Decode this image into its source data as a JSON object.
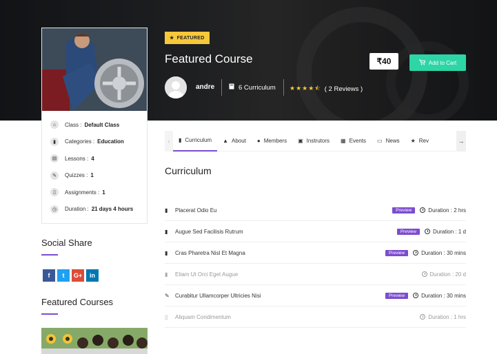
{
  "hero": {
    "badge": "FEATURED",
    "title": "Featured Course",
    "price": "₹40",
    "cart_label": "Add to Cart",
    "author": "andre",
    "curriculum_count": "6 Curriculum",
    "rating_stars": 4.5,
    "stars_text": "★★★★⯪",
    "reviews": "( 2 Reviews )"
  },
  "info": [
    {
      "label": "Class :",
      "value": "Default Class",
      "icon": "class-icon",
      "glyph": "⌂"
    },
    {
      "label": "Categories :",
      "value": "Education",
      "icon": "bookmark-icon",
      "glyph": "▮"
    },
    {
      "label": "Lessons :",
      "value": "4",
      "icon": "book-icon",
      "glyph": "▤"
    },
    {
      "label": "Quizzes :",
      "value": "1",
      "icon": "quiz-icon",
      "glyph": "✎"
    },
    {
      "label": "Assignments :",
      "value": "1",
      "icon": "file-icon",
      "glyph": "▯"
    },
    {
      "label": "Duration :",
      "value": "21 days 4 hours",
      "icon": "clock-icon",
      "glyph": "◷"
    }
  ],
  "sidebar": {
    "social_title": "Social Share",
    "featured_title": "Featured Courses",
    "share": [
      {
        "label": "f",
        "color": "#3b5998",
        "name": "facebook-share-button"
      },
      {
        "label": "t",
        "color": "#1da1f2",
        "name": "twitter-share-button"
      },
      {
        "label": "G+",
        "color": "#dd4b39",
        "name": "googleplus-share-button"
      },
      {
        "label": "in",
        "color": "#0077b5",
        "name": "linkedin-share-button"
      }
    ]
  },
  "tabs": [
    {
      "label": "Curriculum",
      "icon": "book-icon",
      "glyph": "▮",
      "active": true
    },
    {
      "label": "About",
      "icon": "graduation-cap-icon",
      "glyph": "▲"
    },
    {
      "label": "Members",
      "icon": "user-icon",
      "glyph": "●"
    },
    {
      "label": "Instrutors",
      "icon": "id-card-icon",
      "glyph": "▣"
    },
    {
      "label": "Events",
      "icon": "calendar-icon",
      "glyph": "▦"
    },
    {
      "label": "News",
      "icon": "newspaper-icon",
      "glyph": "▭"
    },
    {
      "label": "Rev",
      "icon": "star-icon",
      "glyph": "★"
    }
  ],
  "curriculum": {
    "title": "Curriculum",
    "lessons": [
      {
        "name": "Placerat Odio Eu",
        "preview": "Preview",
        "duration": "Duration : 2 hrs",
        "locked": false,
        "glyph": "▮"
      },
      {
        "name": "Augue Sed Facilisis Rutrum",
        "preview": "Preview",
        "duration": "Duration : 1 d",
        "locked": false,
        "glyph": "▮"
      },
      {
        "name": "Cras Pharetra Nisl Et Magna",
        "preview": "Preview",
        "duration": "Duration : 30 mins",
        "locked": false,
        "glyph": "▮"
      },
      {
        "name": "Etiam Ut Orci Eget Augue",
        "preview": "",
        "duration": "Duration : 20 d",
        "locked": true,
        "glyph": "▮"
      },
      {
        "name": "Curabitur Ullamcorper Ultricies Nisi",
        "preview": "Preview",
        "duration": "Duration : 30 mins",
        "locked": false,
        "glyph": "✎"
      },
      {
        "name": "Aliquam Condimentum",
        "preview": "",
        "duration": "Duration : 1 hrs",
        "locked": true,
        "glyph": "▯"
      }
    ]
  }
}
